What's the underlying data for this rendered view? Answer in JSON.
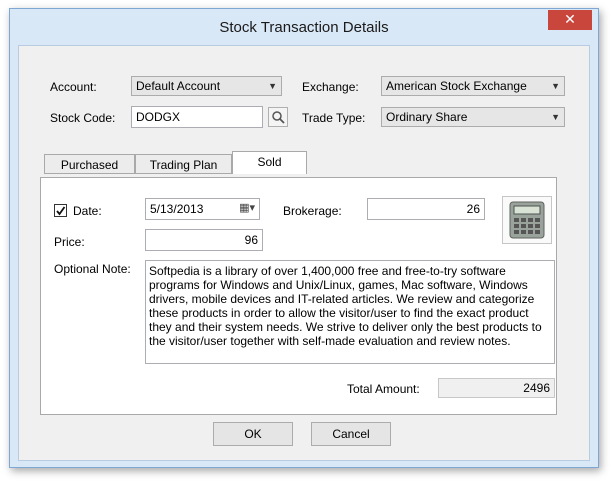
{
  "window": {
    "title": "Stock Transaction Details",
    "close_glyph": "✕"
  },
  "form": {
    "account_label": "Account:",
    "account_value": "Default Account",
    "exchange_label": "Exchange:",
    "exchange_value": "American Stock Exchange",
    "stock_code_label": "Stock Code:",
    "stock_code_value": "DODGX",
    "trade_type_label": "Trade Type:",
    "trade_type_value": "Ordinary Share"
  },
  "tabs": [
    {
      "label": "Purchased"
    },
    {
      "label": "Trading Plan"
    },
    {
      "label": "Sold",
      "active": true
    }
  ],
  "sold": {
    "date_checked": true,
    "date_label": "Date:",
    "date_value": "5/13/2013",
    "brokerage_label": "Brokerage:",
    "brokerage_value": "26",
    "price_label": "Price:",
    "price_value": "96",
    "note_label": "Optional Note:",
    "note_text": "Softpedia is a library of over 1,400,000 free and free-to-try software programs for Windows and Unix/Linux, games, Mac software, Windows drivers, mobile devices and IT-related articles. We review and categorize these products in order to allow the visitor/user to find the exact product they and their system needs. We strive to deliver only the best products to the visitor/user together with self-made evaluation and review notes.",
    "total_label": "Total Amount:",
    "total_value": "2496"
  },
  "buttons": {
    "ok": "OK",
    "cancel": "Cancel"
  },
  "colors": {
    "title_bar": "#d9e8f7",
    "close": "#c9463d",
    "client": "#f0f0f0"
  }
}
